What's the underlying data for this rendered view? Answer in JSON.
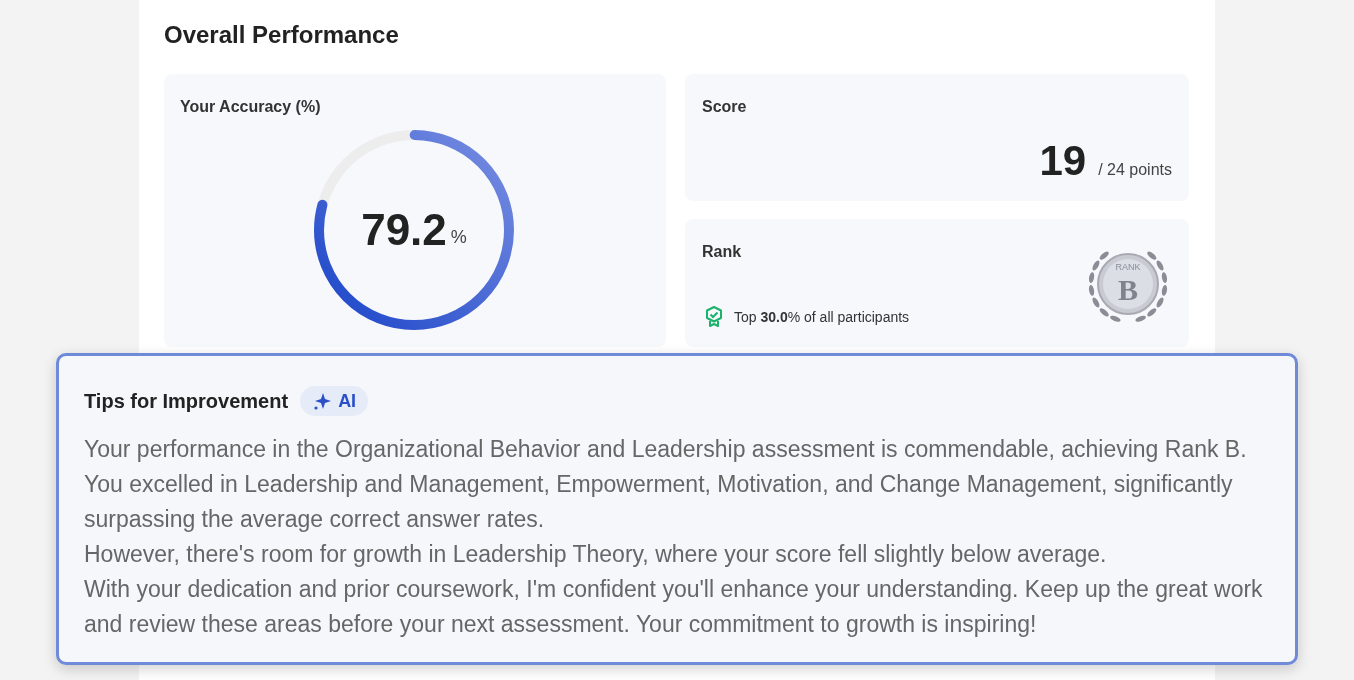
{
  "title": "Overall Performance",
  "accuracy": {
    "label": "Your Accuracy (%)",
    "value": "79.2",
    "unit": "%",
    "level": 0.792
  },
  "score": {
    "label": "Score",
    "value": "19",
    "total": "/ 24 points"
  },
  "rank": {
    "label": "Rank",
    "note": "Top **30.0**% of all participants",
    "badge_caption": "RANK",
    "badge_letter": "B"
  },
  "tips": {
    "title": "Tips for Improvement",
    "badge": "AI",
    "paragraphs": [
      "Your performance in the Organizational Behavior and Leadership assessment is commendable, achieving Rank B.",
      "You excelled in Leadership and Management, Empowerment, Motivation, and Change Management, significantly surpassing the average correct answer rates.",
      "However, there's room for growth in Leadership Theory, where your score fell slightly below average.",
      "With your dedication and prior coursework, I'm confident you'll enhance your understanding. Keep up the great work and review these areas before your next assessment. Your commitment to growth is inspiring!"
    ]
  }
}
